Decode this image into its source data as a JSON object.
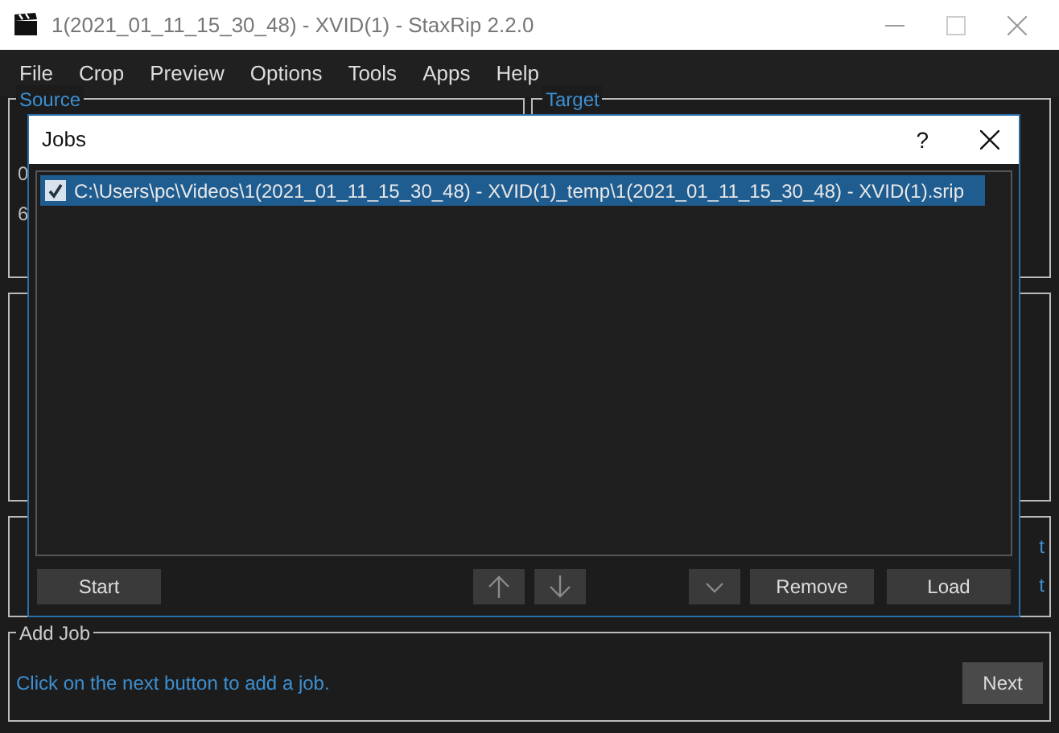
{
  "window": {
    "title": "1(2021_01_11_15_30_48) - XVID(1) - StaxRip 2.2.0"
  },
  "menu": [
    "File",
    "Crop",
    "Preview",
    "Options",
    "Tools",
    "Apps",
    "Help"
  ],
  "source": {
    "label": "Source",
    "fragments": [
      "0",
      "6"
    ]
  },
  "target": {
    "label": "Target"
  },
  "second_group": {
    "right_fragments": [
      "t",
      "t"
    ]
  },
  "dialog": {
    "title": "Jobs",
    "help": "?",
    "jobs": [
      {
        "path": "C:\\Users\\pc\\Videos\\1(2021_01_11_15_30_48) - XVID(1)_temp\\1(2021_01_11_15_30_48) - XVID(1).srip",
        "checked": true,
        "selected": true
      }
    ],
    "start": "Start",
    "remove": "Remove",
    "load": "Load"
  },
  "add_job": {
    "label": "Add Job",
    "hint": "Click on the next button to add a job.",
    "next": "Next"
  }
}
